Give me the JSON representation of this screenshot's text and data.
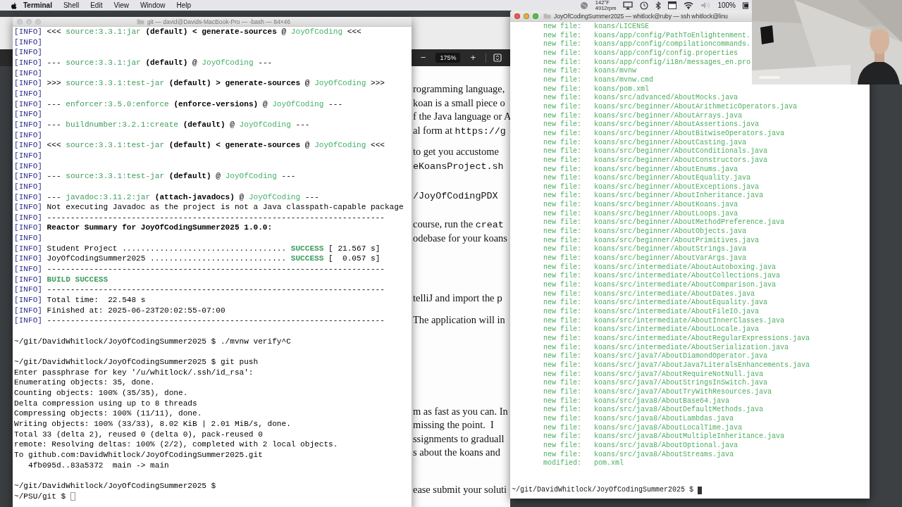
{
  "menu_bar": {
    "items": [
      {
        "label": "Terminal",
        "kind": "app"
      },
      {
        "label": "Shell",
        "kind": "menu"
      },
      {
        "label": "Edit",
        "kind": "menu"
      },
      {
        "label": "View",
        "kind": "menu"
      },
      {
        "label": "Window",
        "kind": "menu"
      },
      {
        "label": "Help",
        "kind": "menu"
      }
    ],
    "status": {
      "temperature": "142°F",
      "fan": "4912rpm",
      "battery": "100%"
    }
  },
  "pdf_viewer": {
    "zoom_out": "−",
    "zoom": "175%",
    "zoom_in": "+",
    "lines": [
      {
        "kind": "text",
        "segments": [
          {
            "kind": "serif",
            "text": "rogramming language,"
          }
        ]
      },
      {
        "kind": "text",
        "segments": [
          {
            "kind": "serif",
            "text": "koan is a small piece o"
          }
        ]
      },
      {
        "kind": "text",
        "segments": [
          {
            "kind": "serif",
            "text": "f the Java language or A"
          }
        ]
      },
      {
        "kind": "text",
        "segments": [
          {
            "kind": "serif",
            "text": "al form at "
          },
          {
            "kind": "mono",
            "text": "https://g"
          }
        ]
      },
      {
        "kind": "gap"
      },
      {
        "kind": "text",
        "segments": [
          {
            "kind": "serif",
            "text": "to get you accustome"
          }
        ]
      },
      {
        "kind": "text",
        "segments": [
          {
            "kind": "mono",
            "text": "eKoansProject.sh"
          }
        ]
      },
      {
        "kind": "gap"
      },
      {
        "kind": "gap"
      },
      {
        "kind": "text",
        "segments": [
          {
            "kind": "mono",
            "text": "/JoyOfCodingPDX"
          }
        ]
      },
      {
        "kind": "gap"
      },
      {
        "kind": "gap"
      },
      {
        "kind": "text",
        "segments": [
          {
            "kind": "serif",
            "text": "course, run the "
          },
          {
            "kind": "mono",
            "text": "creat"
          }
        ]
      },
      {
        "kind": "text",
        "segments": [
          {
            "kind": "serif",
            "text": "odebase for your koans"
          }
        ]
      },
      {
        "kind": "gap"
      },
      {
        "kind": "gap"
      },
      {
        "kind": "gap"
      },
      {
        "kind": "gap"
      },
      {
        "kind": "gap"
      },
      {
        "kind": "gap"
      },
      {
        "kind": "text",
        "segments": [
          {
            "kind": "serif",
            "text": "telliJ and import the "
          },
          {
            "kind": "mono",
            "text": "p"
          }
        ]
      },
      {
        "kind": "gap"
      },
      {
        "kind": "text",
        "segments": [
          {
            "kind": "serif",
            "text": "The application will in"
          }
        ]
      },
      {
        "kind": "gap"
      },
      {
        "kind": "gap"
      },
      {
        "kind": "gap"
      },
      {
        "kind": "gap"
      },
      {
        "kind": "gap"
      },
      {
        "kind": "gap"
      },
      {
        "kind": "gap"
      },
      {
        "kind": "gap"
      },
      {
        "kind": "gap"
      },
      {
        "kind": "gap"
      },
      {
        "kind": "text",
        "segments": [
          {
            "kind": "serif",
            "text": "m as fast as you can. In"
          }
        ]
      },
      {
        "kind": "text",
        "segments": [
          {
            "kind": "serif",
            "text": "missing the point.  I"
          }
        ]
      },
      {
        "kind": "text",
        "segments": [
          {
            "kind": "serif",
            "text": "ssignments to graduall"
          }
        ]
      },
      {
        "kind": "text",
        "segments": [
          {
            "kind": "serif",
            "text": "s about the koans and"
          }
        ]
      },
      {
        "kind": "gap"
      },
      {
        "kind": "gap"
      },
      {
        "kind": "gap"
      },
      {
        "kind": "text",
        "segments": [
          {
            "kind": "serif",
            "text": "ease submit your soluti"
          }
        ]
      }
    ]
  },
  "left_terminal": {
    "title": "git — david@Davids-MacBook-Pro — -bash — 84×46",
    "active": false,
    "lines": [
      {
        "kind": "text",
        "segments": [
          {
            "kind": "info",
            "text": "[INFO]"
          },
          {
            "kind": "plain",
            "text": " <<< "
          },
          {
            "kind": "plugin",
            "text": "source:3.3.1:jar"
          },
          {
            "kind": "bold",
            "text": " (default) < generate-sources"
          },
          {
            "kind": "plain",
            "text": " @ "
          },
          {
            "kind": "project",
            "text": "JoyOfCoding"
          },
          {
            "kind": "plain",
            "text": " <<<"
          }
        ]
      },
      {
        "kind": "text",
        "segments": [
          {
            "kind": "info",
            "text": "[INFO]"
          }
        ]
      },
      {
        "kind": "text",
        "segments": [
          {
            "kind": "info",
            "text": "[INFO]"
          }
        ]
      },
      {
        "kind": "text",
        "segments": [
          {
            "kind": "info",
            "text": "[INFO]"
          },
          {
            "kind": "plain",
            "text": " --- "
          },
          {
            "kind": "plugin",
            "text": "source:3.3.1:jar"
          },
          {
            "kind": "bold",
            "text": " (default)"
          },
          {
            "kind": "plain",
            "text": " @ "
          },
          {
            "kind": "project",
            "text": "JoyOfCoding"
          },
          {
            "kind": "plain",
            "text": " ---"
          }
        ]
      },
      {
        "kind": "text",
        "segments": [
          {
            "kind": "info",
            "text": "[INFO]"
          }
        ]
      },
      {
        "kind": "text",
        "segments": [
          {
            "kind": "info",
            "text": "[INFO]"
          },
          {
            "kind": "plain",
            "text": " >>> "
          },
          {
            "kind": "plugin",
            "text": "source:3.3.1:test-jar"
          },
          {
            "kind": "bold",
            "text": " (default) > generate-sources"
          },
          {
            "kind": "plain",
            "text": " @ "
          },
          {
            "kind": "project",
            "text": "JoyOfCoding"
          },
          {
            "kind": "plain",
            "text": " >>>"
          }
        ]
      },
      {
        "kind": "text",
        "segments": [
          {
            "kind": "info",
            "text": "[INFO]"
          }
        ]
      },
      {
        "kind": "text",
        "segments": [
          {
            "kind": "info",
            "text": "[INFO]"
          },
          {
            "kind": "plain",
            "text": " --- "
          },
          {
            "kind": "plugin",
            "text": "enforcer:3.5.0:enforce"
          },
          {
            "kind": "bold",
            "text": " (enforce-versions)"
          },
          {
            "kind": "plain",
            "text": " @ "
          },
          {
            "kind": "project",
            "text": "JoyOfCoding"
          },
          {
            "kind": "plain",
            "text": " ---"
          }
        ]
      },
      {
        "kind": "text",
        "segments": [
          {
            "kind": "info",
            "text": "[INFO]"
          }
        ]
      },
      {
        "kind": "text",
        "segments": [
          {
            "kind": "info",
            "text": "[INFO]"
          },
          {
            "kind": "plain",
            "text": " --- "
          },
          {
            "kind": "plugin",
            "text": "buildnumber:3.2.1:create"
          },
          {
            "kind": "bold",
            "text": " (default)"
          },
          {
            "kind": "plain",
            "text": " @ "
          },
          {
            "kind": "project",
            "text": "JoyOfCoding"
          },
          {
            "kind": "plain",
            "text": " ---"
          }
        ]
      },
      {
        "kind": "text",
        "segments": [
          {
            "kind": "info",
            "text": "[INFO]"
          }
        ]
      },
      {
        "kind": "text",
        "segments": [
          {
            "kind": "info",
            "text": "[INFO]"
          },
          {
            "kind": "plain",
            "text": " <<< "
          },
          {
            "kind": "plugin",
            "text": "source:3.3.1:test-jar"
          },
          {
            "kind": "bold",
            "text": " (default) < generate-sources"
          },
          {
            "kind": "plain",
            "text": " @ "
          },
          {
            "kind": "project",
            "text": "JoyOfCoding"
          },
          {
            "kind": "plain",
            "text": " <<<"
          }
        ]
      },
      {
        "kind": "text",
        "segments": [
          {
            "kind": "info",
            "text": "[INFO]"
          }
        ]
      },
      {
        "kind": "text",
        "segments": [
          {
            "kind": "info",
            "text": "[INFO]"
          }
        ]
      },
      {
        "kind": "text",
        "segments": [
          {
            "kind": "info",
            "text": "[INFO]"
          },
          {
            "kind": "plain",
            "text": " --- "
          },
          {
            "kind": "plugin",
            "text": "source:3.3.1:test-jar"
          },
          {
            "kind": "bold",
            "text": " (default)"
          },
          {
            "kind": "plain",
            "text": " @ "
          },
          {
            "kind": "project",
            "text": "JoyOfCoding"
          },
          {
            "kind": "plain",
            "text": " ---"
          }
        ]
      },
      {
        "kind": "text",
        "segments": [
          {
            "kind": "info",
            "text": "[INFO]"
          }
        ]
      },
      {
        "kind": "text",
        "segments": [
          {
            "kind": "info",
            "text": "[INFO]"
          },
          {
            "kind": "plain",
            "text": " --- "
          },
          {
            "kind": "plugin",
            "text": "javadoc:3.11.2:jar"
          },
          {
            "kind": "bold",
            "text": " (attach-javadocs)"
          },
          {
            "kind": "plain",
            "text": " @ "
          },
          {
            "kind": "project",
            "text": "JoyOfCoding"
          },
          {
            "kind": "plain",
            "text": " ---"
          }
        ]
      },
      {
        "kind": "text",
        "segments": [
          {
            "kind": "info",
            "text": "[INFO]"
          },
          {
            "kind": "plain",
            "text": " Not executing Javadoc as the project is not a Java classpath-capable package"
          }
        ]
      },
      {
        "kind": "text",
        "segments": [
          {
            "kind": "info",
            "text": "[INFO]"
          },
          {
            "kind": "plain",
            "text": " ------------------------------------------------------------------------"
          }
        ]
      },
      {
        "kind": "text",
        "segments": [
          {
            "kind": "info",
            "text": "[INFO]"
          },
          {
            "kind": "bold",
            "text": " Reactor Summary for JoyOfCodingSummer2025 1.0.0:"
          }
        ]
      },
      {
        "kind": "text",
        "segments": [
          {
            "kind": "info",
            "text": "[INFO]"
          }
        ]
      },
      {
        "kind": "text",
        "segments": [
          {
            "kind": "info",
            "text": "[INFO]"
          },
          {
            "kind": "plain",
            "text": " Student Project ................................... "
          },
          {
            "kind": "success",
            "text": "SUCCESS"
          },
          {
            "kind": "plain",
            "text": " [ 21.567 s]"
          }
        ]
      },
      {
        "kind": "text",
        "segments": [
          {
            "kind": "info",
            "text": "[INFO]"
          },
          {
            "kind": "plain",
            "text": " JoyOfCodingSummer2025 ............................. "
          },
          {
            "kind": "success",
            "text": "SUCCESS"
          },
          {
            "kind": "plain",
            "text": " [  0.057 s]"
          }
        ]
      },
      {
        "kind": "text",
        "segments": [
          {
            "kind": "info",
            "text": "[INFO]"
          },
          {
            "kind": "plain",
            "text": " ------------------------------------------------------------------------"
          }
        ]
      },
      {
        "kind": "text",
        "segments": [
          {
            "kind": "info",
            "text": "[INFO]"
          },
          {
            "kind": "success",
            "text": " BUILD SUCCESS"
          }
        ]
      },
      {
        "kind": "text",
        "segments": [
          {
            "kind": "info",
            "text": "[INFO]"
          },
          {
            "kind": "plain",
            "text": " ------------------------------------------------------------------------"
          }
        ]
      },
      {
        "kind": "text",
        "segments": [
          {
            "kind": "info",
            "text": "[INFO]"
          },
          {
            "kind": "plain",
            "text": " Total time:  22.548 s"
          }
        ]
      },
      {
        "kind": "text",
        "segments": [
          {
            "kind": "info",
            "text": "[INFO]"
          },
          {
            "kind": "plain",
            "text": " Finished at: 2025-06-23T20:02:55-07:00"
          }
        ]
      },
      {
        "kind": "text",
        "segments": [
          {
            "kind": "info",
            "text": "[INFO]"
          },
          {
            "kind": "plain",
            "text": " ------------------------------------------------------------------------"
          }
        ]
      },
      {
        "kind": "blank"
      },
      {
        "kind": "text",
        "segments": [
          {
            "kind": "plain",
            "text": "~/git/DavidWhitlock/JoyOfCodingSummer2025 $ ./mvnw verify^C"
          }
        ]
      },
      {
        "kind": "blank"
      },
      {
        "kind": "text",
        "segments": [
          {
            "kind": "plain",
            "text": "~/git/DavidWhitlock/JoyOfCodingSummer2025 $ git push"
          }
        ]
      },
      {
        "kind": "text",
        "segments": [
          {
            "kind": "plain",
            "text": "Enter passphrase for key '/u/whitlock/.ssh/id_rsa':"
          }
        ]
      },
      {
        "kind": "text",
        "segments": [
          {
            "kind": "plain",
            "text": "Enumerating objects: 35, done."
          }
        ]
      },
      {
        "kind": "text",
        "segments": [
          {
            "kind": "plain",
            "text": "Counting objects: 100% (35/35), done."
          }
        ]
      },
      {
        "kind": "text",
        "segments": [
          {
            "kind": "plain",
            "text": "Delta compression using up to 8 threads"
          }
        ]
      },
      {
        "kind": "text",
        "segments": [
          {
            "kind": "plain",
            "text": "Compressing objects: 100% (11/11), done."
          }
        ]
      },
      {
        "kind": "text",
        "segments": [
          {
            "kind": "plain",
            "text": "Writing objects: 100% (33/33), 8.02 KiB | 2.01 MiB/s, done."
          }
        ]
      },
      {
        "kind": "text",
        "segments": [
          {
            "kind": "plain",
            "text": "Total 33 (delta 2), reused 0 (delta 0), pack-reused 0"
          }
        ]
      },
      {
        "kind": "text",
        "segments": [
          {
            "kind": "plain",
            "text": "remote: Resolving deltas: 100% (2/2), completed with 2 local objects."
          }
        ]
      },
      {
        "kind": "text",
        "segments": [
          {
            "kind": "plain",
            "text": "To github.com:DavidWhitlock/JoyOfCodingSummer2025.git"
          }
        ]
      },
      {
        "kind": "text",
        "segments": [
          {
            "kind": "plain",
            "text": "   4fb095d..83a5372  main -> main"
          }
        ]
      },
      {
        "kind": "blank"
      },
      {
        "kind": "text",
        "segments": [
          {
            "kind": "plain",
            "text": "~/git/DavidWhitlock/JoyOfCodingSummer2025 $"
          }
        ]
      },
      {
        "kind": "text",
        "cursor": true,
        "segments": [
          {
            "kind": "plain",
            "text": "~/PSU/git $ "
          }
        ]
      }
    ]
  },
  "right_terminal": {
    "title": "JoyOfCodingSummer2025 — whitlock@ruby — ssh whitlock@linu",
    "active": true,
    "lines": [
      {
        "kind": "staged",
        "text": "new file:   koans/LICENSE"
      },
      {
        "kind": "staged",
        "text": "new file:   koans/app/config/PathToEnlightenment."
      },
      {
        "kind": "staged",
        "text": "new file:   koans/app/config/compilationcommands."
      },
      {
        "kind": "staged",
        "text": "new file:   koans/app/config/config.properties"
      },
      {
        "kind": "staged",
        "text": "new file:   koans/app/config/i18n/messages_en.pro"
      },
      {
        "kind": "staged",
        "text": "new file:   koans/mvnw"
      },
      {
        "kind": "staged",
        "text": "new file:   koans/mvnw.cmd"
      },
      {
        "kind": "staged",
        "text": "new file:   koans/pom.xml"
      },
      {
        "kind": "staged",
        "text": "new file:   koans/src/advanced/AboutMocks.java"
      },
      {
        "kind": "staged",
        "text": "new file:   koans/src/beginner/AboutArithmeticOperators.java"
      },
      {
        "kind": "staged",
        "text": "new file:   koans/src/beginner/AboutArrays.java"
      },
      {
        "kind": "staged",
        "text": "new file:   koans/src/beginner/AboutAssertions.java"
      },
      {
        "kind": "staged",
        "text": "new file:   koans/src/beginner/AboutBitwiseOperators.java"
      },
      {
        "kind": "staged",
        "text": "new file:   koans/src/beginner/AboutCasting.java"
      },
      {
        "kind": "staged",
        "text": "new file:   koans/src/beginner/AboutConditionals.java"
      },
      {
        "kind": "staged",
        "text": "new file:   koans/src/beginner/AboutConstructors.java"
      },
      {
        "kind": "staged",
        "text": "new file:   koans/src/beginner/AboutEnums.java"
      },
      {
        "kind": "staged",
        "text": "new file:   koans/src/beginner/AboutEquality.java"
      },
      {
        "kind": "staged",
        "text": "new file:   koans/src/beginner/AboutExceptions.java"
      },
      {
        "kind": "staged",
        "text": "new file:   koans/src/beginner/AboutInheritance.java"
      },
      {
        "kind": "staged",
        "text": "new file:   koans/src/beginner/AboutKoans.java"
      },
      {
        "kind": "staged",
        "text": "new file:   koans/src/beginner/AboutLoops.java"
      },
      {
        "kind": "staged",
        "text": "new file:   koans/src/beginner/AboutMethodPreference.java"
      },
      {
        "kind": "staged",
        "text": "new file:   koans/src/beginner/AboutObjects.java"
      },
      {
        "kind": "staged",
        "text": "new file:   koans/src/beginner/AboutPrimitives.java"
      },
      {
        "kind": "staged",
        "text": "new file:   koans/src/beginner/AboutStrings.java"
      },
      {
        "kind": "staged",
        "text": "new file:   koans/src/beginner/AboutVarArgs.java"
      },
      {
        "kind": "staged",
        "text": "new file:   koans/src/intermediate/AboutAutoboxing.java"
      },
      {
        "kind": "staged",
        "text": "new file:   koans/src/intermediate/AboutCollections.java"
      },
      {
        "kind": "staged",
        "text": "new file:   koans/src/intermediate/AboutComparison.java"
      },
      {
        "kind": "staged",
        "text": "new file:   koans/src/intermediate/AboutDates.java"
      },
      {
        "kind": "staged",
        "text": "new file:   koans/src/intermediate/AboutEquality.java"
      },
      {
        "kind": "staged",
        "text": "new file:   koans/src/intermediate/AboutFileIO.java"
      },
      {
        "kind": "staged",
        "text": "new file:   koans/src/intermediate/AboutInnerClasses.java"
      },
      {
        "kind": "staged",
        "text": "new file:   koans/src/intermediate/AboutLocale.java"
      },
      {
        "kind": "staged",
        "text": "new file:   koans/src/intermediate/AboutRegularExpressions.java"
      },
      {
        "kind": "staged",
        "text": "new file:   koans/src/intermediate/AboutSerialization.java"
      },
      {
        "kind": "staged",
        "text": "new file:   koans/src/java7/AboutDiamondOperator.java"
      },
      {
        "kind": "staged",
        "text": "new file:   koans/src/java7/AboutJava7LiteralsEnhancements.java"
      },
      {
        "kind": "staged",
        "text": "new file:   koans/src/java7/AboutRequireNotNull.java"
      },
      {
        "kind": "staged",
        "text": "new file:   koans/src/java7/AboutStringsInSwitch.java"
      },
      {
        "kind": "staged",
        "text": "new file:   koans/src/java7/AboutTryWithResources.java"
      },
      {
        "kind": "staged",
        "text": "new file:   koans/src/java8/AboutBase64.java"
      },
      {
        "kind": "staged",
        "text": "new file:   koans/src/java8/AboutDefaultMethods.java"
      },
      {
        "kind": "staged",
        "text": "new file:   koans/src/java8/AboutLambdas.java"
      },
      {
        "kind": "staged",
        "text": "new file:   koans/src/java8/AboutLocalTime.java"
      },
      {
        "kind": "staged",
        "text": "new file:   koans/src/java8/AboutMultipleInheritance.java"
      },
      {
        "kind": "staged",
        "text": "new file:   koans/src/java8/AboutOptional.java"
      },
      {
        "kind": "staged",
        "text": "new file:   koans/src/java8/AboutStreams.java"
      },
      {
        "kind": "staged",
        "text": "modified:   pom.xml"
      },
      {
        "kind": "blank"
      },
      {
        "kind": "blank"
      },
      {
        "kind": "prompt",
        "cursor": true,
        "text": "~/git/DavidWhitlock/JoyOfCodingSummer2025 $ "
      }
    ]
  }
}
